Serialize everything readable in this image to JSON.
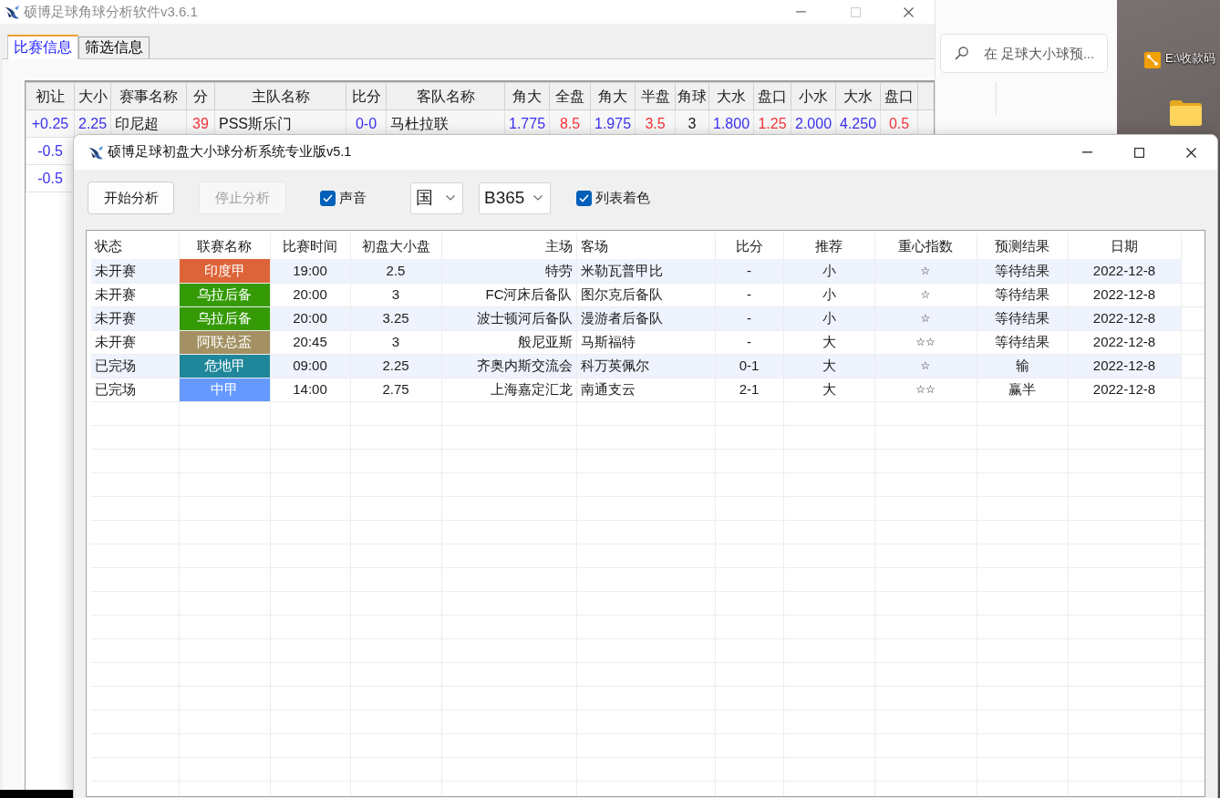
{
  "desktop": {
    "shortcut": {
      "label": "E:\\收款码"
    }
  },
  "explorer_window": {
    "search": {
      "placeholder": "在 足球大小球预..."
    }
  },
  "back_window": {
    "title": "硕博足球角球分析软件v3.6.1",
    "tabs": [
      {
        "label": "比赛信息",
        "selected": true
      },
      {
        "label": "筛选信息",
        "selected": false
      }
    ],
    "table": {
      "columns": [
        {
          "label": "初让",
          "color": "#3b30f2"
        },
        {
          "label": "大小",
          "color": "#3b30f2"
        },
        {
          "label": "赛事名称"
        },
        {
          "label": "分",
          "color": "#f5343a"
        },
        {
          "label": "主队名称"
        },
        {
          "label": "比分",
          "color": "#3b30f2"
        },
        {
          "label": "客队名称"
        },
        {
          "label": "角大",
          "color": "#3b30f2"
        },
        {
          "label": "全盘",
          "color": "#f5343a"
        },
        {
          "label": "角大",
          "color": "#3b30f2"
        },
        {
          "label": "半盘",
          "color": "#f5343a"
        },
        {
          "label": "角球"
        },
        {
          "label": "大水",
          "color": "#3b30f2"
        },
        {
          "label": "盘口",
          "color": "#f5343a"
        },
        {
          "label": "小水",
          "color": "#3b30f2"
        },
        {
          "label": "大水",
          "color": "#3b30f2"
        },
        {
          "label": "盘口",
          "color": "#f5343a"
        }
      ],
      "rows": [
        [
          "+0.25",
          "2.25",
          "印尼超",
          "39",
          "PSS斯乐门",
          "0-0",
          "马杜拉联",
          "1.775",
          "8.5",
          "1.975",
          "3.5",
          "3",
          "1.800",
          "1.25",
          "2.000",
          "4.250",
          "0.5"
        ],
        [
          "-0.5"
        ],
        [
          "-0.5"
        ]
      ]
    }
  },
  "main_window": {
    "title": "硕博足球初盘大小球分析系统专业版v5.1",
    "toolbar": [
      {
        "kind": "button",
        "label": "开始分析",
        "disabled": false
      },
      {
        "kind": "button",
        "label": "停止分析",
        "disabled": true
      },
      {
        "kind": "checkbox",
        "label": "声音",
        "checked": true
      },
      {
        "kind": "select",
        "value": "国"
      },
      {
        "kind": "select",
        "value": "B365"
      },
      {
        "kind": "checkbox",
        "label": "列表着色",
        "checked": true
      }
    ],
    "table": {
      "columns": [
        "状态",
        "联赛名称",
        "比赛时间",
        "初盘大小盘",
        "主场",
        "客场",
        "比分",
        "推荐",
        "重心指数",
        "预测结果",
        "日期"
      ],
      "rows": [
        {
          "status": "未开赛",
          "league": {
            "name": "印度甲",
            "color": "#dd6338"
          },
          "time": "19:00",
          "line": "2.5",
          "home": "特劳",
          "away": "米勒瓦普甲比",
          "score": "-",
          "pick": "小",
          "index": "☆",
          "result": "等待结果",
          "date": "2022-12-8"
        },
        {
          "status": "未开赛",
          "league": {
            "name": "乌拉后备",
            "color": "#349b06"
          },
          "time": "20:00",
          "line": "3",
          "home": "FC河床后备队",
          "away": "图尔克后备队",
          "score": "-",
          "pick": "小",
          "index": "☆",
          "result": "等待结果",
          "date": "2022-12-8"
        },
        {
          "status": "未开赛",
          "league": {
            "name": "乌拉后备",
            "color": "#349b06"
          },
          "time": "20:00",
          "line": "3.25",
          "home": "波士顿河后备队",
          "away": "漫游者后备队",
          "score": "-",
          "pick": "小",
          "index": "☆",
          "result": "等待结果",
          "date": "2022-12-8"
        },
        {
          "status": "未开赛",
          "league": {
            "name": "阿联总盃",
            "color": "#a39163"
          },
          "time": "20:45",
          "line": "3",
          "home": "般尼亚斯",
          "away": "马斯福特",
          "score": "-",
          "pick": "大",
          "index": "☆☆",
          "result": "等待结果",
          "date": "2022-12-8"
        },
        {
          "status": "已完场",
          "league": {
            "name": "危地甲",
            "color": "#1f8799"
          },
          "time": "09:00",
          "line": "2.25",
          "home": "齐奥内斯交流会",
          "away": "科万英佩尔",
          "score": "0-1",
          "pick": "大",
          "index": "☆",
          "result": "输",
          "date": "2022-12-8"
        },
        {
          "status": "已完场",
          "league": {
            "name": "中甲",
            "color": "#6699ff"
          },
          "time": "14:00",
          "line": "2.75",
          "home": "上海嘉定汇龙",
          "away": "南通支云",
          "score": "2-1",
          "pick": "大",
          "index": "☆☆",
          "result": "赢半",
          "date": "2022-12-8"
        }
      ]
    }
  }
}
